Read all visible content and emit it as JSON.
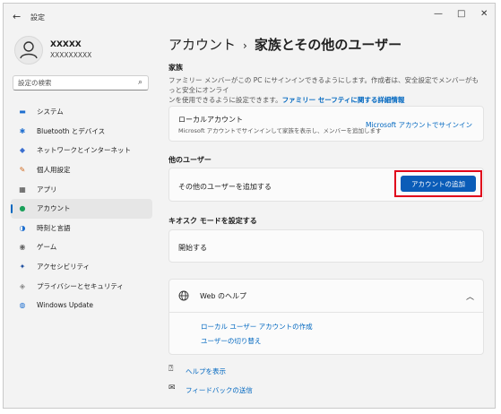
{
  "window": {
    "app_title": "設定",
    "back_icon": "←",
    "min_icon": "—",
    "max_icon": "□",
    "close_icon": "✕"
  },
  "user": {
    "name": "XXXXX",
    "email": "XXXXXXXXX"
  },
  "search": {
    "placeholder": "設定の検索",
    "icon": "⌕"
  },
  "sidebar": {
    "items": [
      {
        "label": "システム",
        "icon": "▬",
        "color": "#1f6fd0"
      },
      {
        "label": "Bluetooth とデバイス",
        "icon": "✱",
        "color": "#1f6fd0"
      },
      {
        "label": "ネットワークとインターネット",
        "icon": "◆",
        "color": "#3b6fd0"
      },
      {
        "label": "個人用設定",
        "icon": "✎",
        "color": "#d06a1f"
      },
      {
        "label": "アプリ",
        "icon": "▦",
        "color": "#444"
      },
      {
        "label": "アカウント",
        "icon": "●",
        "color": "#1aa05a"
      },
      {
        "label": "時刻と言語",
        "icon": "◑",
        "color": "#1f6fd0"
      },
      {
        "label": "ゲーム",
        "icon": "◉",
        "color": "#666"
      },
      {
        "label": "アクセシビリティ",
        "icon": "✦",
        "color": "#1f4fa0"
      },
      {
        "label": "プライバシーとセキュリティ",
        "icon": "◈",
        "color": "#888"
      },
      {
        "label": "Windows Update",
        "icon": "◍",
        "color": "#1f6fd0"
      }
    ],
    "active_index": 5
  },
  "header": {
    "crumb1": "アカウント",
    "separator": "›",
    "crumb2": "家族とその他のユーザー"
  },
  "family": {
    "heading": "家族",
    "description": "ファミリー メンバーがこの PC にサインインできるようにします。作成者は、安全設定でメンバーがもっと安全にオンライ\nンを使用できるように設定できます。",
    "link": "ファミリー セーフティに関する詳細情報",
    "card_title": "ローカルアカウント",
    "card_sub": "Microsoft アカウントでサインインして家族を表示し、メンバーを追加します",
    "card_link": "Microsoft アカウントでサインイン"
  },
  "others": {
    "heading": "他のユーザー",
    "card_title": "その他のユーザーを追加する",
    "button": "アカウントの追加"
  },
  "kiosk": {
    "heading": "キオスク モードを設定する",
    "card_title": "開始する"
  },
  "help": {
    "title": "Web のヘルプ",
    "links": [
      "ローカル ユーザー アカウントの作成",
      "ユーザーの切り替え"
    ]
  },
  "footer": {
    "help_label": "ヘルプを表示",
    "feedback_label": "フィードバックの送信"
  },
  "colors": {
    "accent": "#0067c0",
    "button": "#0a5cb8",
    "highlight_border": "#e0001b"
  }
}
